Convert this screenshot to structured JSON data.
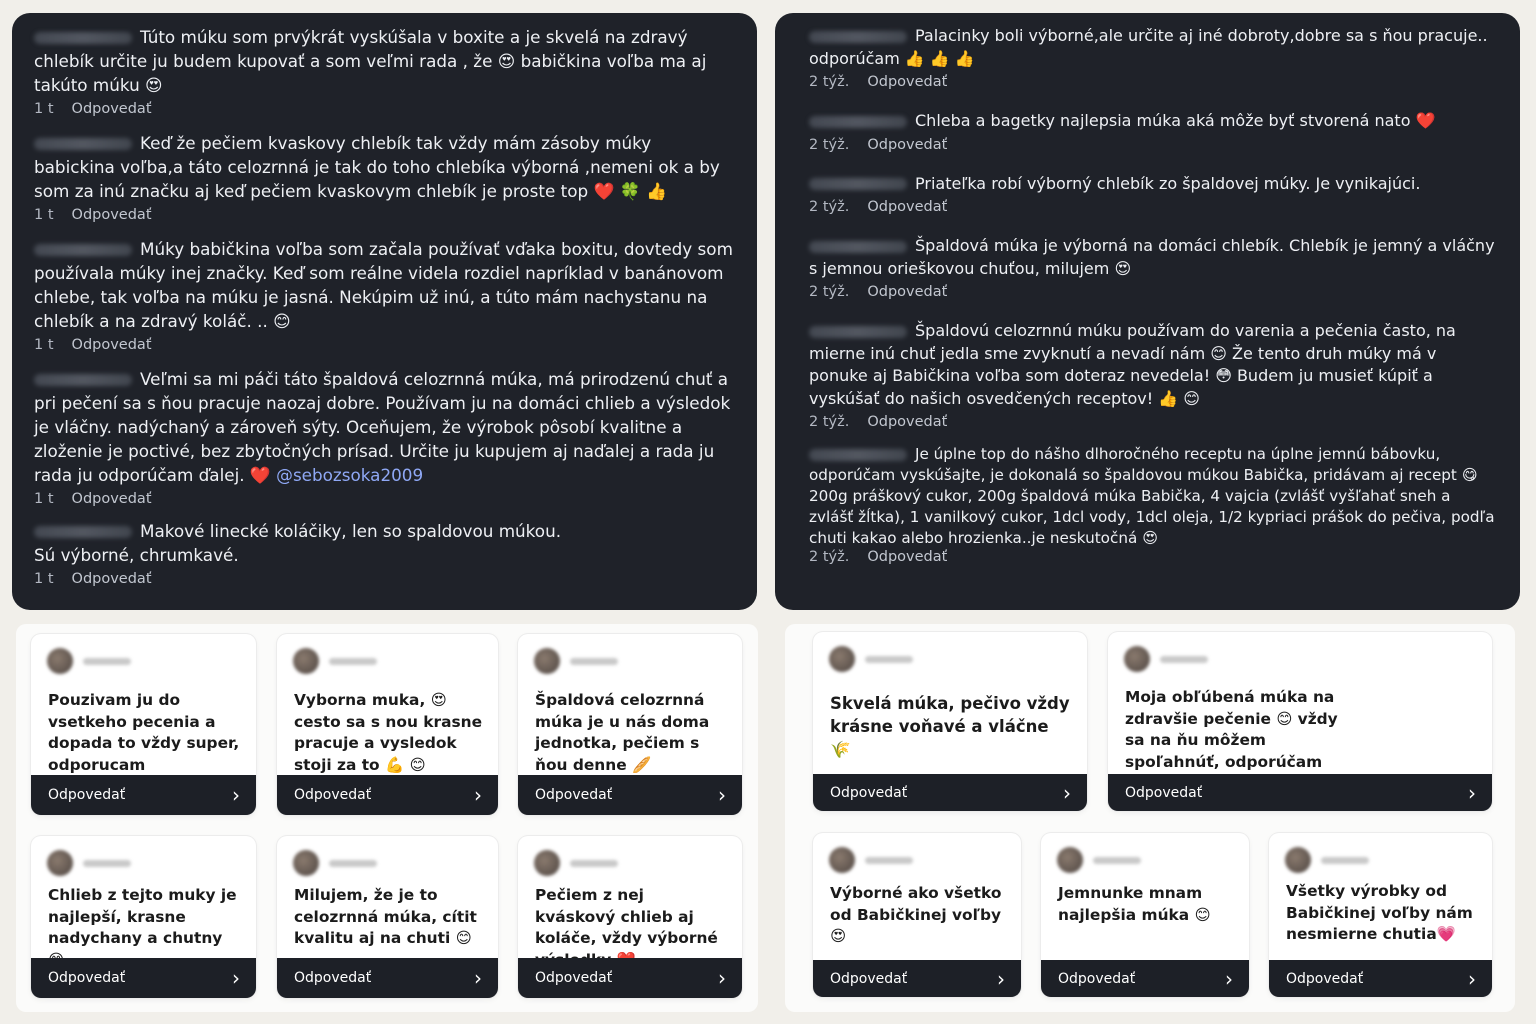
{
  "left_comments": [
    {
      "text": "Túto múku som prvýkrát vyskúšala v boxite a je skvelá na zdravý chlebík určite ju budem kupovať a som veľmi rada , že 😍 babičkina voľba ma aj takúto múku 😍",
      "time": "1 t",
      "reply": "Odpovedať"
    },
    {
      "text": "Keď že pečiem kvaskovy chlebík tak vždy mám zásoby múky babickina voľba,a táto celozrnná je tak do toho chlebíka výborná ,nemeni ok a by som za inú značku aj keď pečiem kvaskovym chlebík je proste top ❤️ 🍀 👍",
      "time": "1 t",
      "reply": "Odpovedať"
    },
    {
      "text": "Múky babičkina voľba som začala používať vďaka boxitu, dovtedy som používala múky inej značky. Keď som reálne videla rozdiel napríklad v banánovom chlebe, tak voľba na múku je jasná. Nekúpim už inú, a túto mám nachystanu na chlebík a na zdravý koláč. .. 😊",
      "time": "1 t",
      "reply": "Odpovedať"
    },
    {
      "text": "Veľmi sa mi páči táto špaldová celozrnná múka, má prirodzenú chuť a pri pečení sa s ňou pracuje naozaj dobre. Používam ju na domáci chlieb a výsledok je vláčny. nadýchaný a zároveň sýty. Oceňujem, že výrobok pôsobí kvalitne a zloženie je poctivé, bez zbytočných prísad. Určite ju kupujem aj naďalej a rada ju rada ju odporúčam ďalej. ❤️",
      "mention": "@sebozsoka2009",
      "time": "1 t",
      "reply": "Odpovedať"
    },
    {
      "text": "Makové linecké koláčiky, len so spaldovou múkou.",
      "text2": "Sú výborné, chrumkavé.",
      "time": "1 t",
      "reply": "Odpovedať"
    }
  ],
  "right_comments": [
    {
      "text": "Palacinky boli výborné,ale určite aj iné dobroty,dobre sa s ňou pracuje.. odporúčam 👍 👍 👍",
      "time": "2 týž.",
      "reply": "Odpovedať"
    },
    {
      "text": "Chleba a bagetky najlepsia múka aká môže byť stvorená nato ❤️",
      "time": "2 týž.",
      "reply": "Odpovedať"
    },
    {
      "text": "Priateľka robí výborný chlebík zo špaldovej múky. Je vynikajúci.",
      "time": "2 týž.",
      "reply": "Odpovedať"
    },
    {
      "text": "Špaldová múka je výborná na domáci chlebík. Chlebík je jemný a vláčny s jemnou orieškovou chuťou, milujem 😍",
      "time": "2 týž.",
      "reply": "Odpovedať"
    },
    {
      "text": "Špaldovú celozrnnú múku používam do varenia a pečenia často, na mierne inú chuť jedla sme zvyknutí a nevadí nám 😊 Že tento druh múky má v ponuke aj Babičkina voľba som doteraz nevedela! 😳 Budem ju musieť kúpiť a vyskúšať do našich osvedčených receptov! 👍 😊",
      "time": "2 týž.",
      "reply": "Odpovedať"
    },
    {
      "text": "Je úplne top do nášho dlhoročného receptu na úplne jemnú bábovku, odporúčam vyskúšajte, je dokonalá so špaldovou múkou Babička, pridávam aj recept 😋 200g práškový cukor, 200g špaldová múka Babička, 4 vajcia (zvlášť vyšľahať sneh a zvlášť žĺtka), 1 vanilkový cukor, 1dcl vody, 1dcl oleja, 1/2 kypriaci prášok do pečiva, podľa chuti kakao alebo hrozienka..je neskutočná 😍",
      "time": "2 týž.",
      "reply": "Odpovedať"
    }
  ],
  "cards_left": [
    {
      "text": "Pouzivam ju do vsetkeho pecenia a dopada to vždy super, odporucam",
      "button": "Odpovedať"
    },
    {
      "text": "Vyborna muka, 😍 cesto sa s nou krasne pracuje a vysledok stoji za to 💪 😊",
      "button": "Odpovedať"
    },
    {
      "text": "Špaldová celozrnná múka je u nás doma jednotka, pečiem s ňou denne 🥖",
      "button": "Odpovedať"
    },
    {
      "text": "Chlieb z tejto muky je najlepší, krasne nadychany a chutny 😋",
      "button": "Odpovedať"
    },
    {
      "text": "Milujem, že je to celozrnná múka, cítit kvalitu aj na chuti 😊",
      "button": "Odpovedať"
    },
    {
      "text": "Pečiem z nej kváskový chlieb aj koláče, vždy výborné výsledky ❤️",
      "button": "Odpovedať"
    }
  ],
  "cards_right": [
    {
      "text": "Skvelá múka, pečivo vždy krásne voňavé a vláčne 🌾",
      "button": "Odpovedať"
    },
    {
      "text": "Moja obľúbená múka na zdravšie pečenie 😊 vždy sa na ňu môžem spoľahnúť, odporúčam každému 🙌",
      "button": "Odpovedať"
    },
    {
      "text": "Výborné ako všetko od Babičkinej voľby 😍",
      "button": "Odpovedať"
    },
    {
      "text": "Jemnunke mnam najlepšia múka 😊",
      "button": "Odpovedať"
    },
    {
      "text": "Všetky výrobky od Babičkinej voľby nám nesmierne chutia💗",
      "button": "Odpovedať"
    }
  ],
  "icons": {
    "card_chevron": "chevron-right-icon"
  },
  "colors": {
    "panel_bg": "#1f2229",
    "button_bg": "#1d2027",
    "mention": "#8fa8f5"
  }
}
